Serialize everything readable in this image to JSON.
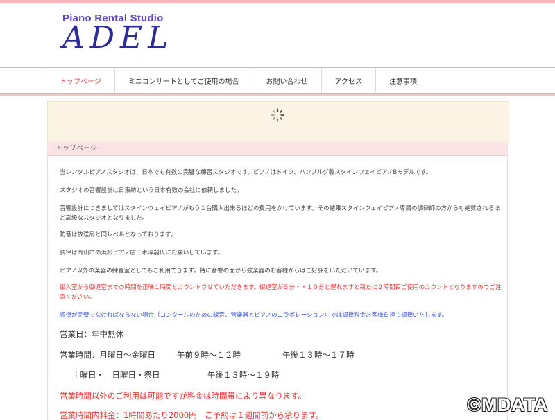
{
  "header": {
    "logo_sub": "Piano Rental Studio",
    "logo_main": "ADEL"
  },
  "nav": {
    "items": [
      {
        "label": "トップページ"
      },
      {
        "label": "ミニコンサートとしてご使用の場合"
      },
      {
        "label": "お問い合わせ"
      },
      {
        "label": "アクセス"
      },
      {
        "label": "注意事項"
      }
    ]
  },
  "slider": {
    "loading_icon": "spinner-icon"
  },
  "page": {
    "heading": "トップページ",
    "paragraphs": [
      "当レンタルピアノスタジオは、日本でも有数の完璧な練習スタジオです。ピアノはドイツ、ハンブルグ製スタインウェイピアノBモデルです。",
      "スタジオの音響設計は日東紡という日本有数の会社に依頼しました。",
      "音響設計につきましてはスタインウェイピアノがもう１台購入出来るほどの費用をかけています。その結果スタインウェイピアノ専属の調律師の方からも絶賛されるほど高級なスタジオとなりました。",
      "防音は放送局と同レベルとなっております。",
      "調律は岡山市の浜松ピアノ店三木淳嗣氏にお願いしています。",
      "ピアノ以外の楽器の練習室としてもご利用できます。特に音響の面から弦楽器のお客様からはご好評をいただいています。",
      "御入室から御退室までの時間を正味１時間とカウントさせていただきます。御退室が５分・・１０分と遅れますと新たに２時間目ご使用のカウントとなりますのでご注意ください。",
      "調律が完璧でなければならない場合（コンクールのための録音、管楽器とピアノのコラボレーション）では調律料金お客様負担で調律いたします。"
    ],
    "business_days": "営業日：年中無休",
    "hours_weekday_label": "営業時間：月曜日～金曜日",
    "hours_weekday_am": "午前９時～１２時",
    "hours_weekday_pm": "午後１３時～１７時",
    "hours_weekend_label": "土曜日・　日曜日・祭日",
    "hours_weekend": "午後１３時～１９時",
    "notice_red": "営業時間以外のご利用は可能ですが料金は時間帯により異なります。",
    "notice_red2": "営業時間内料金：1時間あたり2000円　ご予約は１週間前から承ります。"
  },
  "watermark": "©MDATA"
}
